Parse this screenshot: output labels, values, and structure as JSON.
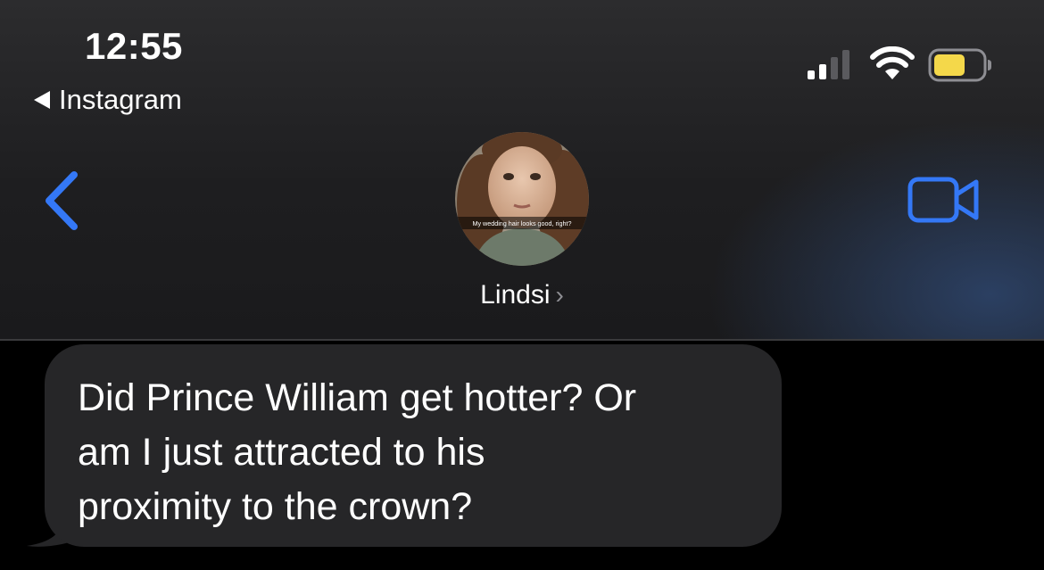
{
  "status_bar": {
    "time": "12:55",
    "back_app_label": "Instagram",
    "signal_icon": "cellular-signal-icon",
    "wifi_icon": "wifi-icon",
    "battery_icon": "battery-icon",
    "battery_color": "#f4d84a",
    "battery_level": 0.65
  },
  "nav": {
    "back_icon": "chevron-left-icon",
    "video_icon": "video-call-icon",
    "accent_color": "#3478f6"
  },
  "contact": {
    "name": "Lindsi",
    "avatar_caption": "My wedding hair looks good, right?"
  },
  "messages": [
    {
      "direction": "incoming",
      "bubble_color": "#262628",
      "lines": [
        "Did Prince William get hotter? Or",
        "am I just attracted to his",
        "proximity to the crown?"
      ]
    }
  ]
}
